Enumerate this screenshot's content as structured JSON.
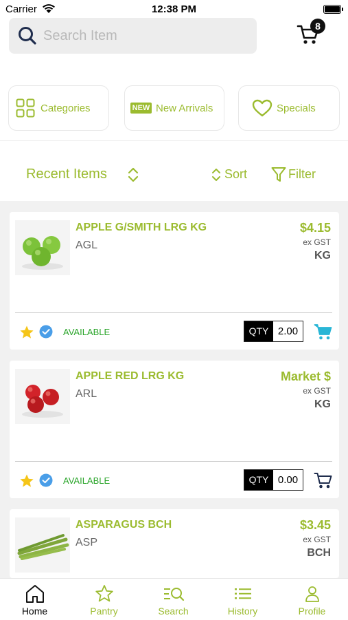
{
  "status_bar": {
    "carrier": "Carrier",
    "time": "12:38 PM"
  },
  "search": {
    "placeholder": "Search Item"
  },
  "cart": {
    "badge_count": "8"
  },
  "quick_links": [
    {
      "label": "Categories",
      "icon": "grid-icon"
    },
    {
      "label": "New Arrivals",
      "icon": "new-badge-icon",
      "badge_text": "NEW"
    },
    {
      "label": "Specials",
      "icon": "heart-icon"
    }
  ],
  "list_header": {
    "title": "Recent Items",
    "sort_label": "Sort",
    "filter_label": "Filter"
  },
  "products": [
    {
      "name": "APPLE G/SMITH LRG KG",
      "code": "AGL",
      "price": "$4.15",
      "tax_note": "ex GST",
      "unit": "KG",
      "status": "AVAILABLE",
      "qty_label": "QTY",
      "qty": "2.00",
      "in_cart": true,
      "image": "green-apples"
    },
    {
      "name": "APPLE RED LRG KG",
      "code": "ARL",
      "price": "Market $",
      "tax_note": "ex GST",
      "unit": "KG",
      "status": "AVAILABLE",
      "qty_label": "QTY",
      "qty": "0.00",
      "in_cart": false,
      "image": "red-apples"
    },
    {
      "name": "ASPARAGUS BCH",
      "code": "ASP",
      "price": "$3.45",
      "tax_note": "ex GST",
      "unit": "BCH",
      "image": "asparagus"
    }
  ],
  "tabs": [
    {
      "label": "Home",
      "icon": "home-icon",
      "active": true
    },
    {
      "label": "Pantry",
      "icon": "star-icon",
      "active": false
    },
    {
      "label": "Search",
      "icon": "search-list-icon",
      "active": false
    },
    {
      "label": "History",
      "icon": "list-icon",
      "active": false
    },
    {
      "label": "Profile",
      "icon": "person-icon",
      "active": false
    }
  ],
  "colors": {
    "accent": "#9bbb2f",
    "available": "#2aa52a",
    "cart_active": "#29b6d6",
    "star": "#f5c518",
    "check": "#4a9ee8"
  }
}
